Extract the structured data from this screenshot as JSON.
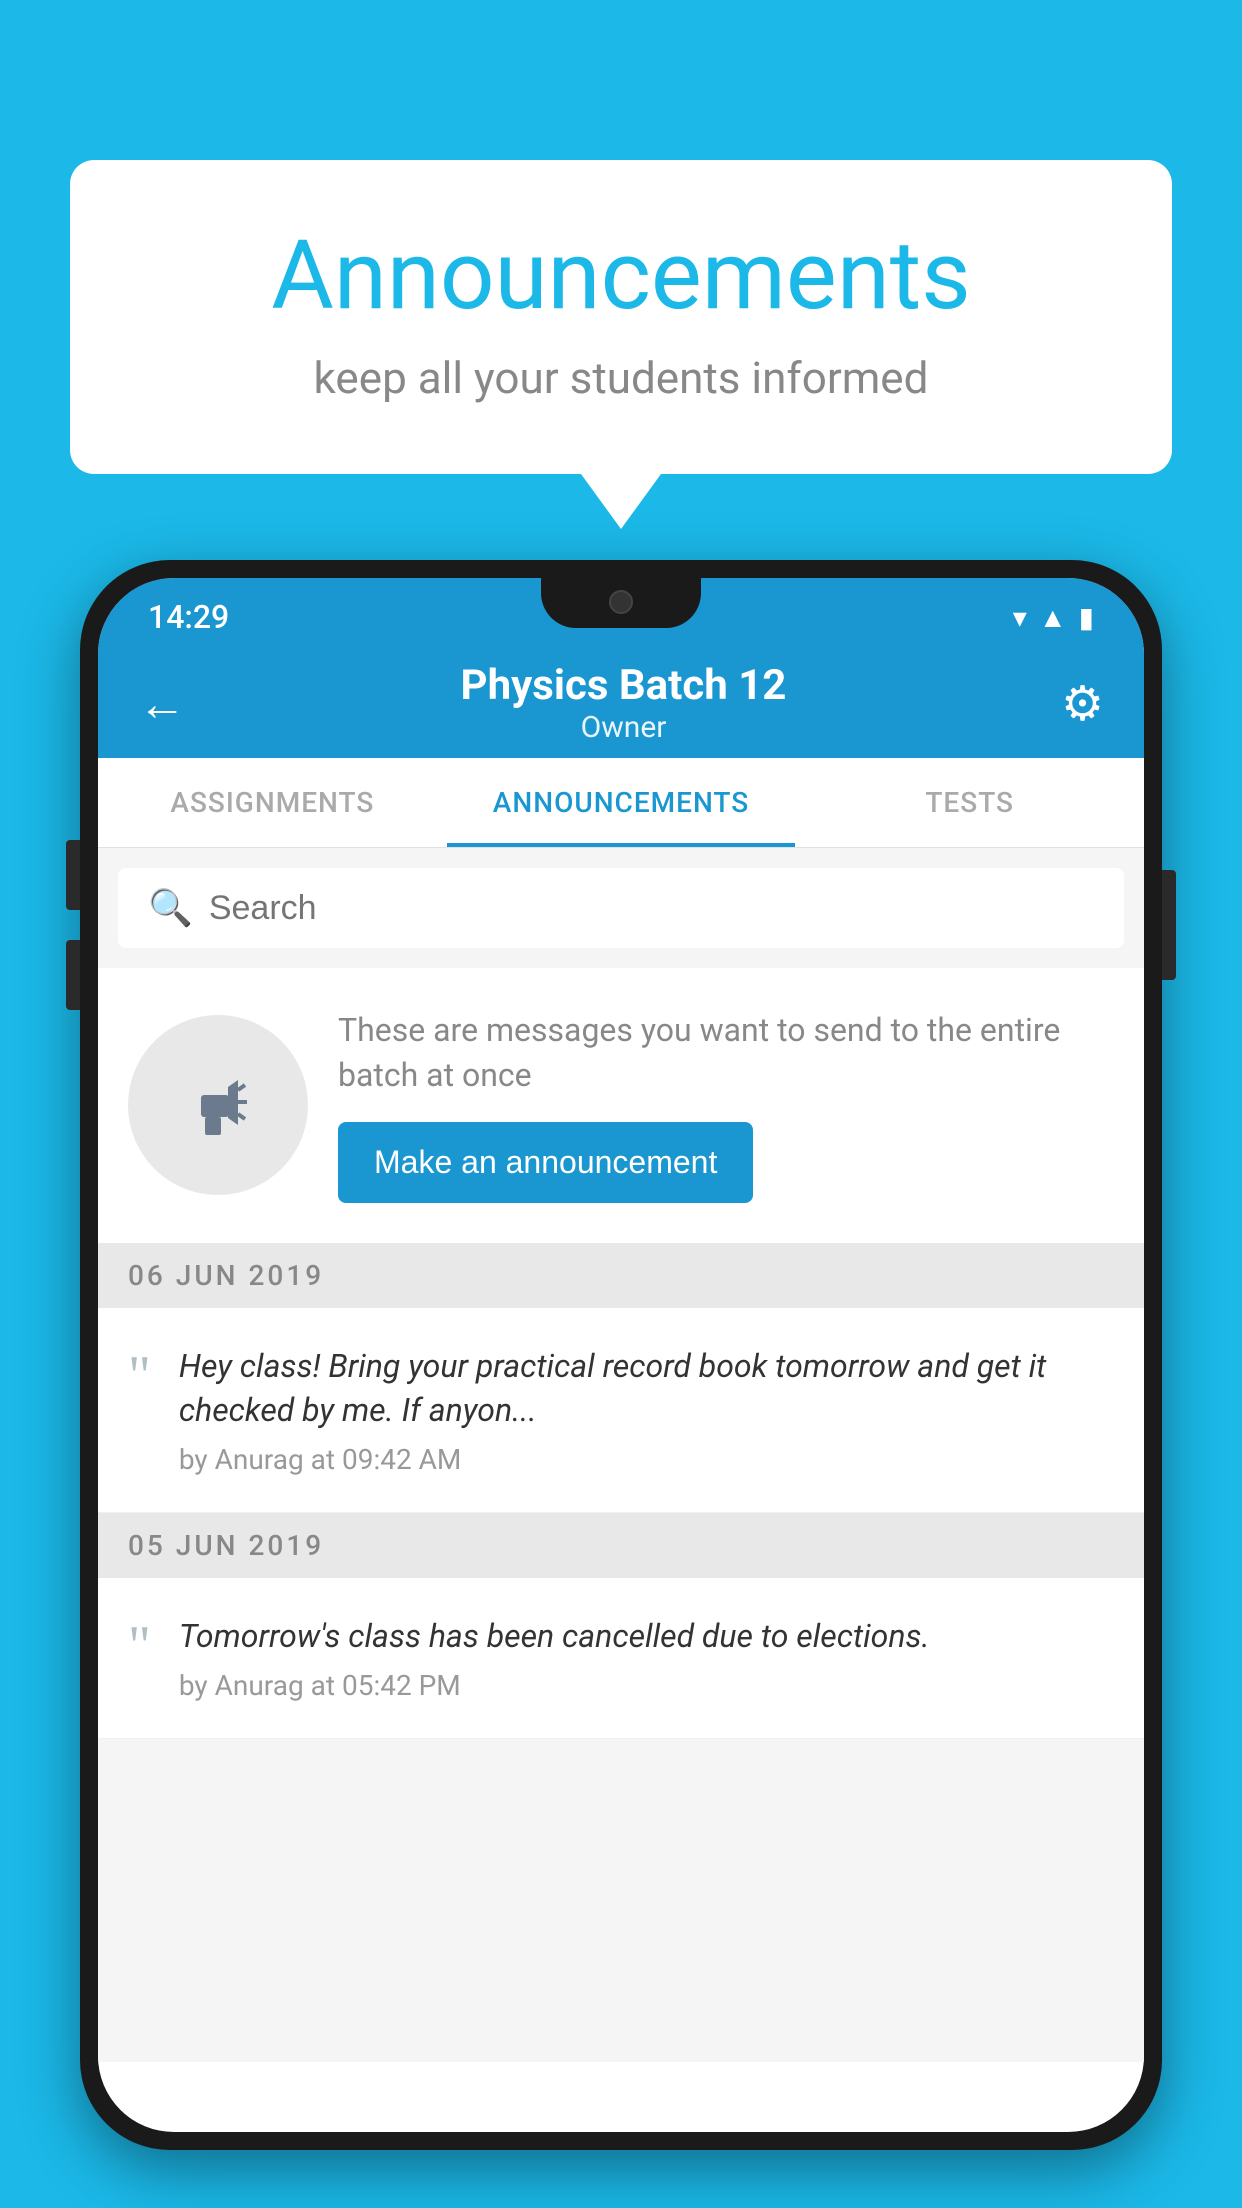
{
  "background_color": "#1BB8E8",
  "bubble": {
    "title": "Announcements",
    "subtitle": "keep all your students informed"
  },
  "phone": {
    "status_bar": {
      "time": "14:29",
      "icons": [
        "wifi",
        "signal",
        "battery"
      ]
    },
    "app_bar": {
      "back_label": "←",
      "title": "Physics Batch 12",
      "subtitle": "Owner",
      "gear_label": "⚙"
    },
    "tabs": [
      {
        "label": "ASSIGNMENTS",
        "active": false
      },
      {
        "label": "ANNOUNCEMENTS",
        "active": true
      },
      {
        "label": "TESTS",
        "active": false
      },
      {
        "label": "...",
        "active": false
      }
    ],
    "search": {
      "placeholder": "Search"
    },
    "promo": {
      "text": "These are messages you want to send to the entire batch at once",
      "button_label": "Make an announcement"
    },
    "announcements": [
      {
        "date": "06  JUN  2019",
        "text": "Hey class! Bring your practical record book tomorrow and get it checked by me. If anyon...",
        "meta": "by Anurag at 09:42 AM"
      },
      {
        "date": "05  JUN  2019",
        "text": "Tomorrow's class has been cancelled due to elections.",
        "meta": "by Anurag at 05:42 PM"
      }
    ]
  }
}
